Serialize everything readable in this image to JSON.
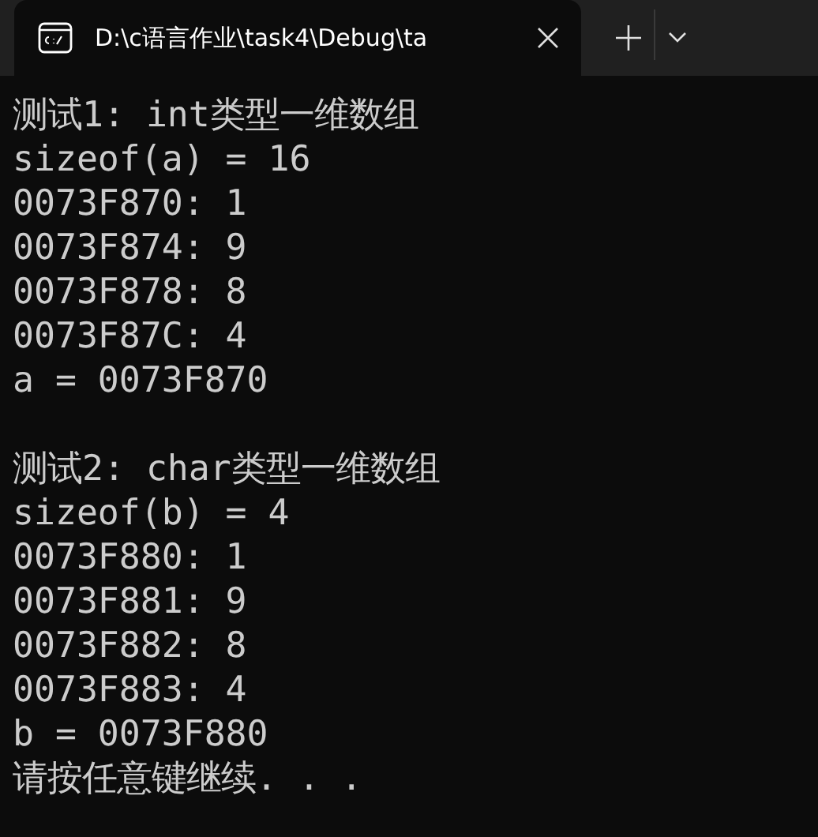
{
  "tabs": [
    {
      "title": "D:\\c语言作业\\task4\\Debug\\ta",
      "selected": true
    }
  ],
  "blocks": [
    {
      "lines": [
        "测试1: int类型一维数组",
        "sizeof(a) = 16",
        "0073F870: 1",
        "0073F874: 9",
        "0073F878: 8",
        "0073F87C: 4",
        "a = 0073F870"
      ]
    },
    {
      "lines": [
        "测试2: char类型一维数组",
        "sizeof(b) = 4",
        "0073F880: 1",
        "0073F881: 9",
        "0073F882: 8",
        "0073F883: 4",
        "b = 0073F880",
        "请按任意键继续. . ."
      ]
    }
  ]
}
